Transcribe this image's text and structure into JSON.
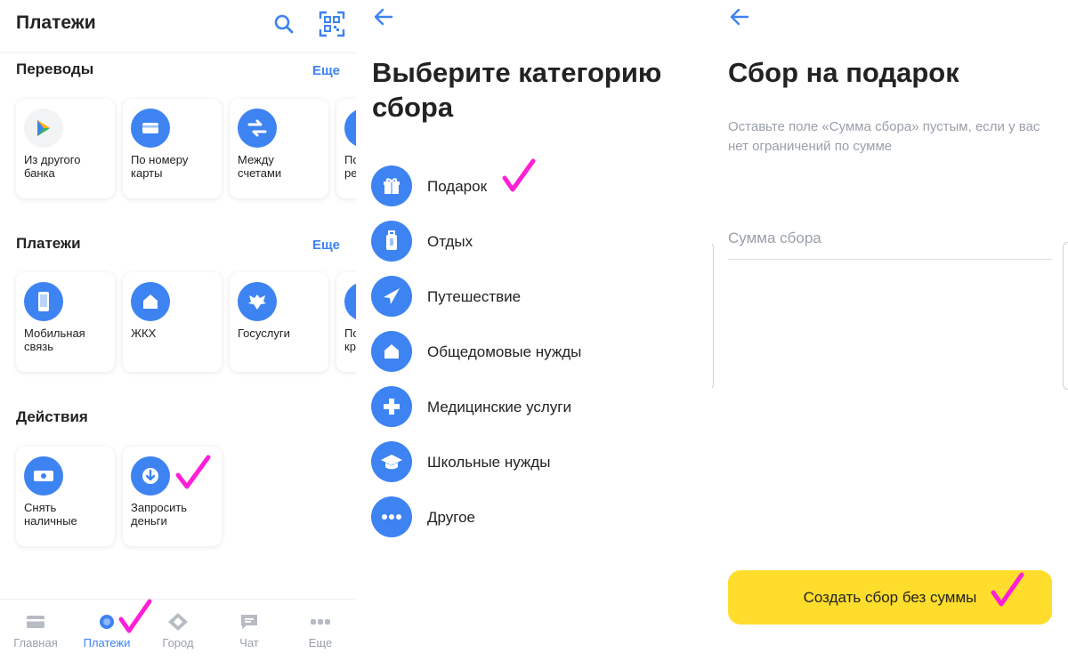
{
  "colors": {
    "accent": "#3d83f2",
    "check": "#ff1fd7",
    "cta": "#ffdd2d",
    "muted": "#9aa0a8"
  },
  "payments_screen": {
    "title": "Платежи",
    "search_icon": "search-icon",
    "qr_icon": "qr-scan-icon",
    "sections": {
      "transfers": {
        "title": "Переводы",
        "more": "Еще",
        "tiles": [
          {
            "label": "Из другого\nбанка",
            "icon": "bank-transfer-icon"
          },
          {
            "label": "По номеру\nкарты",
            "icon": "card-icon"
          },
          {
            "label": "Между\nсчетами",
            "icon": "swap-arrows-icon"
          },
          {
            "label": "По\nре",
            "icon": "requisites-icon"
          }
        ]
      },
      "payments": {
        "title": "Платежи",
        "more": "Еще",
        "tiles": [
          {
            "label": "Мобильная\nсвязь",
            "icon": "phone-icon"
          },
          {
            "label": "ЖКХ",
            "icon": "house-icon"
          },
          {
            "label": "Госуслуги",
            "icon": "emblem-icon"
          },
          {
            "label": "По\nкр",
            "icon": "credit-icon"
          }
        ]
      },
      "actions": {
        "title": "Действия",
        "tiles": [
          {
            "label": "Снять\nналичные",
            "icon": "cash-icon"
          },
          {
            "label": "Запросить\nденьги",
            "icon": "download-arrow-icon"
          }
        ]
      }
    },
    "bottom_nav": [
      {
        "label": "Главная",
        "icon": "home-card-icon",
        "active": false
      },
      {
        "label": "Платежи",
        "icon": "payments-dot-icon",
        "active": true
      },
      {
        "label": "Город",
        "icon": "city-icon",
        "active": false
      },
      {
        "label": "Чат",
        "icon": "chat-icon",
        "active": false
      },
      {
        "label": "Еще",
        "icon": "more-dots-icon",
        "active": false
      }
    ]
  },
  "category_screen": {
    "back_icon": "back-arrow-icon",
    "title": "Выберите категорию сбора",
    "categories": [
      {
        "label": "Подарок",
        "icon": "gift-icon"
      },
      {
        "label": "Отдых",
        "icon": "luggage-icon"
      },
      {
        "label": "Путешествие",
        "icon": "airplane-icon"
      },
      {
        "label": "Общедомовые нужды",
        "icon": "house-icon"
      },
      {
        "label": "Медицинские услуги",
        "icon": "medical-cross-icon"
      },
      {
        "label": "Школьные нужды",
        "icon": "graduation-cap-icon"
      },
      {
        "label": "Другое",
        "icon": "more-dots-icon"
      }
    ]
  },
  "gift_screen": {
    "back_icon": "back-arrow-icon",
    "title": "Сбор на подарок",
    "hint": "Оставьте поле «Сумма сбора» пустым, если у вас нет ограничений по сумме",
    "amount_placeholder": "Сумма сбора",
    "amount_value": "",
    "create_button": "Создать сбор без суммы"
  }
}
